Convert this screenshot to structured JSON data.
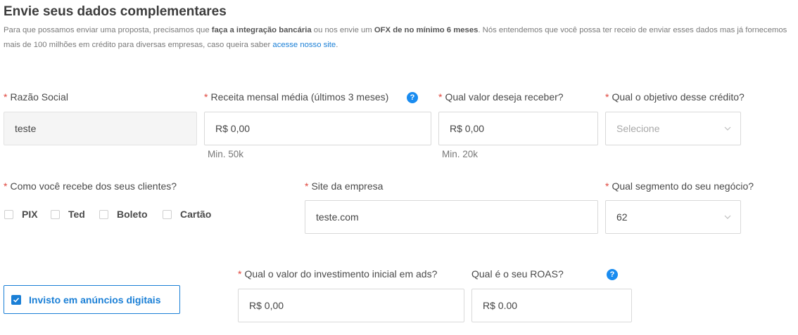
{
  "header": {
    "title": "Envie seus dados complementares",
    "desc_part1": "Para que possamos enviar uma proposta, precisamos que ",
    "desc_bold1": "faça a integração bancária",
    "desc_part2": " ou nos envie um ",
    "desc_bold2": "OFX de no mínimo 6 meses",
    "desc_part3": ". Nós entendemos que você possa ter receio de enviar esses dados mas já fornecemos mais de 100 milhões em crédito para diversas empresas, caso queira saber ",
    "desc_link": "acesse nosso site",
    "desc_end": "."
  },
  "required_mark": "*",
  "help_glyph": "?",
  "fields": {
    "razao_social": {
      "label": "Razão Social",
      "value": "teste"
    },
    "receita": {
      "label": "Receita mensal média (últimos 3 meses)",
      "value": "R$ 0,00",
      "hint": "Min. 50k"
    },
    "valor": {
      "label": "Qual valor deseja receber?",
      "value": "R$ 0,00",
      "hint": "Min. 20k"
    },
    "objetivo": {
      "label": "Qual o objetivo desse crédito?",
      "placeholder": "Selecione"
    },
    "recebimento": {
      "label": "Como você recebe dos seus clientes?",
      "options": [
        "PIX",
        "Ted",
        "Boleto",
        "Cartão"
      ]
    },
    "site": {
      "label": "Site da empresa",
      "value": "teste.com"
    },
    "segmento": {
      "label": "Qual segmento do seu negócio?",
      "value": "62"
    },
    "investimento": {
      "label": "Qual o valor do investimento inicial em ads?",
      "value": "R$ 0,00"
    },
    "roas": {
      "label": "Qual é o seu ROAS?",
      "value": "R$ 0.00"
    }
  },
  "ads_toggle": {
    "label": "Invisto em anúncios digitais",
    "checked": true
  },
  "colors": {
    "accent": "#1a7fd6",
    "required": "#e0453c",
    "help": "#1a8cf0"
  }
}
